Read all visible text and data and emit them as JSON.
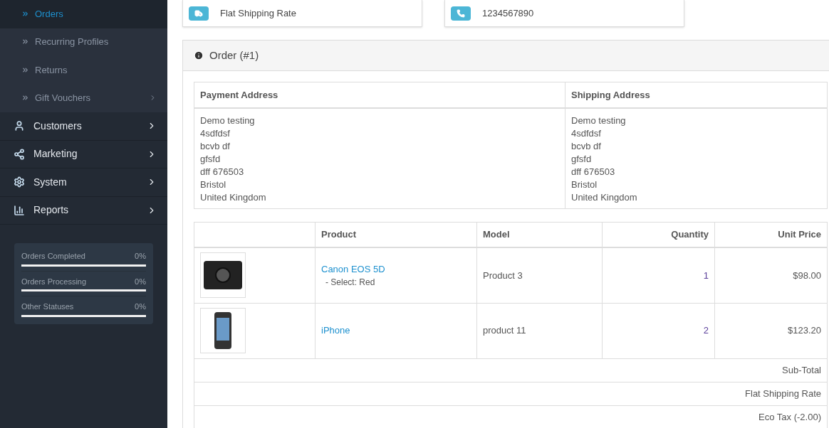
{
  "sidebar": {
    "items": [
      {
        "label": "Orders",
        "kind": "sub",
        "selected": true,
        "arrow": false
      },
      {
        "label": "Recurring Profiles",
        "kind": "sub",
        "selected": false,
        "arrow": false
      },
      {
        "label": "Returns",
        "kind": "sub",
        "selected": false,
        "arrow": false
      },
      {
        "label": "Gift Vouchers",
        "kind": "sub",
        "selected": false,
        "arrow": true
      },
      {
        "label": "Customers",
        "kind": "main",
        "selected": false,
        "arrow": true
      },
      {
        "label": "Marketing",
        "kind": "main",
        "selected": false,
        "arrow": true
      },
      {
        "label": "System",
        "kind": "main",
        "selected": false,
        "arrow": true
      },
      {
        "label": "Reports",
        "kind": "main",
        "selected": false,
        "arrow": true
      }
    ],
    "stats": [
      {
        "label": "Orders Completed",
        "value": "0%",
        "level": 0
      },
      {
        "label": "Orders Processing",
        "value": "0%",
        "level": 0
      },
      {
        "label": "Other Statuses",
        "value": "0%",
        "level": 0
      }
    ]
  },
  "info_cards": [
    {
      "text": "Flat Shipping Rate"
    },
    {
      "text": "1234567890"
    }
  ],
  "order_panel": {
    "title": "Order (#1)",
    "addresses": {
      "columns": [
        "Payment Address",
        "Shipping Address"
      ],
      "values": [
        [
          "Demo testing",
          "4sdfdsf",
          "bcvb df",
          "gfsfd",
          "dff 676503",
          "Bristol",
          "United Kingdom"
        ],
        [
          "Demo testing",
          "4sdfdsf",
          "bcvb df",
          "gfsfd",
          "dff 676503",
          "Bristol",
          "United Kingdom"
        ]
      ]
    },
    "products": {
      "columns": [
        "Product",
        "Model",
        "Quantity",
        "Unit Price"
      ],
      "rows": [
        {
          "name": "Canon EOS 5D",
          "option": "- Select: Red",
          "model": "Product 3",
          "quantity": "1",
          "price": "$98.00"
        },
        {
          "name": "iPhone",
          "model": "product 11",
          "quantity": "2",
          "price": "$123.20"
        }
      ],
      "totals": [
        "Sub-Total",
        "Flat Shipping Rate",
        "Eco Tax (-2.00)"
      ]
    }
  }
}
